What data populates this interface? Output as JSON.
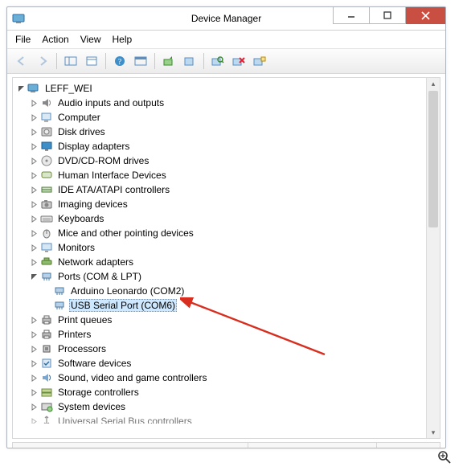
{
  "window": {
    "title": "Device Manager",
    "min_tooltip": "Minimize",
    "max_tooltip": "Maximize",
    "close_tooltip": "Close"
  },
  "menu": {
    "file": "File",
    "action": "Action",
    "view": "View",
    "help": "Help"
  },
  "toolbar": {
    "back": "Back",
    "forward": "Forward",
    "up": "Show/Hide Console Tree",
    "props": "Properties",
    "help": "Help",
    "refresh": "Refresh",
    "scan": "Scan for hardware changes",
    "uninstall": "Uninstall",
    "update": "Update Driver",
    "disable": "Disable",
    "enable": "Enable"
  },
  "root": {
    "name": "LEFF_WEI"
  },
  "nodes": [
    {
      "label": "Audio inputs and outputs",
      "icon": "speaker-icon"
    },
    {
      "label": "Computer",
      "icon": "computer-icon"
    },
    {
      "label": "Disk drives",
      "icon": "disk-icon"
    },
    {
      "label": "Display adapters",
      "icon": "display-icon"
    },
    {
      "label": "DVD/CD-ROM drives",
      "icon": "optical-icon"
    },
    {
      "label": "Human Interface Devices",
      "icon": "hid-icon"
    },
    {
      "label": "IDE ATA/ATAPI controllers",
      "icon": "ide-icon"
    },
    {
      "label": "Imaging devices",
      "icon": "camera-icon"
    },
    {
      "label": "Keyboards",
      "icon": "keyboard-icon"
    },
    {
      "label": "Mice and other pointing devices",
      "icon": "mouse-icon"
    },
    {
      "label": "Monitors",
      "icon": "monitor-icon"
    },
    {
      "label": "Network adapters",
      "icon": "network-icon"
    },
    {
      "label": "Ports (COM & LPT)",
      "icon": "port-icon",
      "expanded": true,
      "children": [
        {
          "label": "Arduino Leonardo (COM2)",
          "icon": "port-icon"
        },
        {
          "label": "USB Serial Port (COM6)",
          "icon": "port-icon",
          "selected": true
        }
      ]
    },
    {
      "label": "Print queues",
      "icon": "printer-icon"
    },
    {
      "label": "Printers",
      "icon": "printer-icon"
    },
    {
      "label": "Processors",
      "icon": "cpu-icon"
    },
    {
      "label": "Software devices",
      "icon": "software-icon"
    },
    {
      "label": "Sound, video and game controllers",
      "icon": "sound-icon"
    },
    {
      "label": "Storage controllers",
      "icon": "storage-icon"
    },
    {
      "label": "System devices",
      "icon": "system-icon"
    },
    {
      "label": "Universal Serial Bus controllers",
      "icon": "usb-icon",
      "cut": true
    }
  ],
  "annotation": {
    "arrow_color": "#d82e20"
  }
}
